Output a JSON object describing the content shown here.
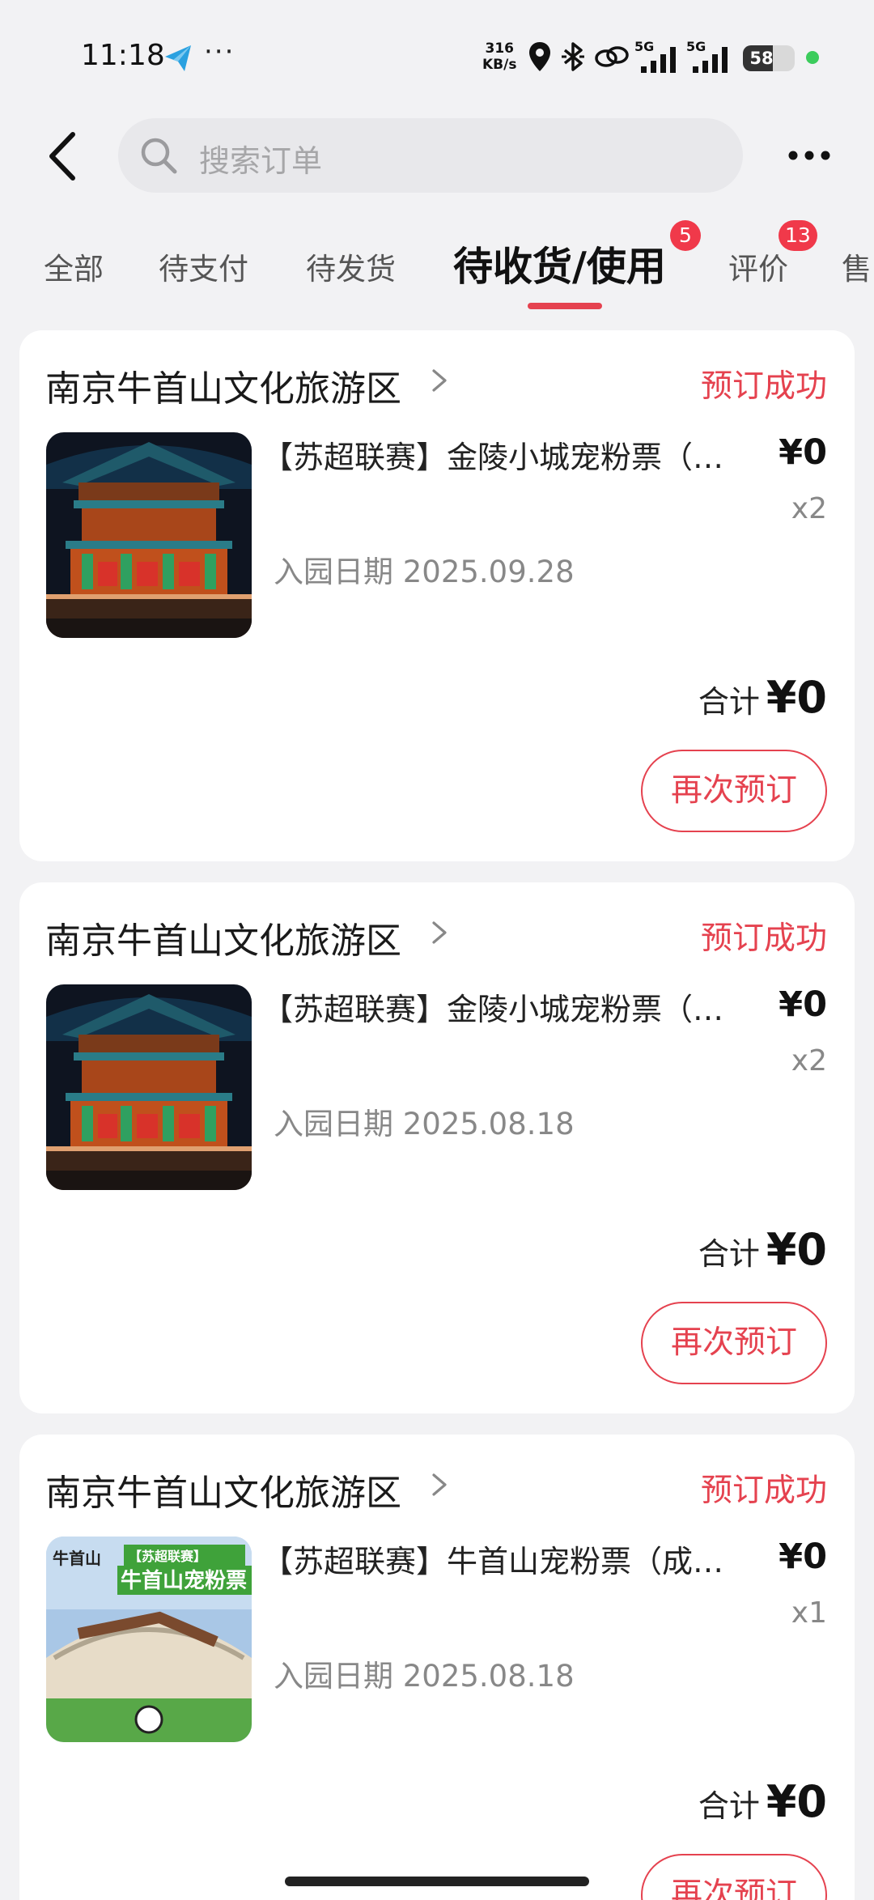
{
  "status_bar": {
    "time": "11:18",
    "more_dots": "···",
    "net_speed_value": "316",
    "net_speed_unit": "KB/s",
    "network_1": "5G",
    "network_2": "5G",
    "battery": "58",
    "battery_level": 0.58,
    "icons": [
      "telegram-icon",
      "location-icon",
      "bluetooth-icon",
      "link-icon",
      "signal-icon",
      "signal-icon",
      "battery-icon"
    ]
  },
  "header": {
    "back_icon": "chevron-left-icon",
    "search_placeholder": "搜索订单",
    "more_icon": "more-dots-icon"
  },
  "tabs": [
    {
      "label": "全部"
    },
    {
      "label": "待支付"
    },
    {
      "label": "待发货"
    },
    {
      "label": "待收货/使用",
      "badge": "5",
      "active": true
    },
    {
      "label": "评价",
      "badge": "13"
    },
    {
      "label": "售"
    }
  ],
  "orders": [
    {
      "shop": "南京牛首山文化旅游区",
      "status": "预订成功",
      "product": "【苏超联赛】金陵小城宠粉票（成人票）",
      "price": "¥0",
      "qty": "x2",
      "date": "入园日期 2025.09.28",
      "total_label": "合计",
      "total": "¥0",
      "action": "再次预订"
    },
    {
      "shop": "南京牛首山文化旅游区",
      "status": "预订成功",
      "product": "【苏超联赛】金陵小城宠粉票（成人票）",
      "price": "¥0",
      "qty": "x2",
      "date": "入园日期 2025.08.18",
      "total_label": "合计",
      "total": "¥0",
      "action": "再次预订"
    },
    {
      "shop": "南京牛首山文化旅游区",
      "status": "预订成功",
      "product": "【苏超联赛】牛首山宠粉票（成人票）",
      "price": "¥0",
      "qty": "x1",
      "date": "入园日期 2025.08.18",
      "total_label": "合计",
      "total": "¥0",
      "action": "再次预订",
      "thumb_logo": "牛首山",
      "thumb_tag": "【苏超联赛】",
      "thumb_title": "牛首山宠粉票"
    }
  ],
  "colors": {
    "accent": "#e5424f",
    "badge": "#f0394a",
    "background": "#f2f2f4"
  }
}
